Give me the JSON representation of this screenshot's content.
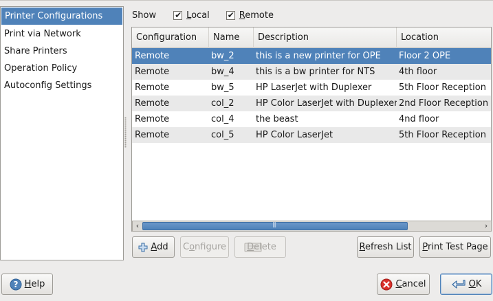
{
  "sidebar": {
    "items": [
      {
        "label": "Printer Configurations",
        "selected": true
      },
      {
        "label": "Print via Network",
        "selected": false
      },
      {
        "label": "Share Printers",
        "selected": false
      },
      {
        "label": "Operation Policy",
        "selected": false
      },
      {
        "label": "Autoconfig Settings",
        "selected": false
      }
    ]
  },
  "show": {
    "label": "Show",
    "local": {
      "label_u": "L",
      "label_rest": "ocal",
      "checked": true
    },
    "remote": {
      "label_u": "R",
      "label_rest": "emote",
      "checked": true
    }
  },
  "table": {
    "columns": [
      "Configuration",
      "Name",
      "Description",
      "Location"
    ],
    "rows": [
      {
        "configuration": "Remote",
        "name": "bw_2",
        "description": "this is a new printer for OPE",
        "location": "Floor 2 OPE",
        "selected": true
      },
      {
        "configuration": "Remote",
        "name": "bw_4",
        "description": "this is a bw printer for NTS",
        "location": "4th floor",
        "selected": false
      },
      {
        "configuration": "Remote",
        "name": "bw_5",
        "description": "HP LaserJet with Duplexer",
        "location": "5th Floor Reception",
        "selected": false
      },
      {
        "configuration": "Remote",
        "name": "col_2",
        "description": "HP Color LaserJet with Duplexer",
        "location": "2nd Floor Reception",
        "selected": false
      },
      {
        "configuration": "Remote",
        "name": "col_4",
        "description": "the beast",
        "location": "4nd floor",
        "selected": false
      },
      {
        "configuration": "Remote",
        "name": "col_5",
        "description": "HP Color LaserJet",
        "location": "5th Floor Reception",
        "selected": false
      }
    ]
  },
  "buttons": {
    "add": {
      "u": "A",
      "rest": "dd",
      "icon": "plus-icon"
    },
    "configure": {
      "pre": "C",
      "u": "o",
      "rest": "nfigure",
      "enabled": false
    },
    "delete": {
      "u": "D",
      "rest": "elete",
      "icon": "delete-icon",
      "enabled": false
    },
    "refresh": {
      "u": "R",
      "rest": "efresh List"
    },
    "print_test": {
      "pre": "",
      "u": "P",
      "rest": "rint Test Page"
    },
    "help": {
      "u": "H",
      "rest": "elp",
      "icon": "help-icon"
    },
    "cancel": {
      "u": "C",
      "rest": "ancel",
      "icon": "cancel-icon"
    },
    "ok": {
      "u": "O",
      "rest": "K",
      "icon": "ok-arrow-icon"
    }
  },
  "colors": {
    "selection": "#4f82b9",
    "window_bg": "#edeceb",
    "row_alt": "#e9e9e9"
  }
}
